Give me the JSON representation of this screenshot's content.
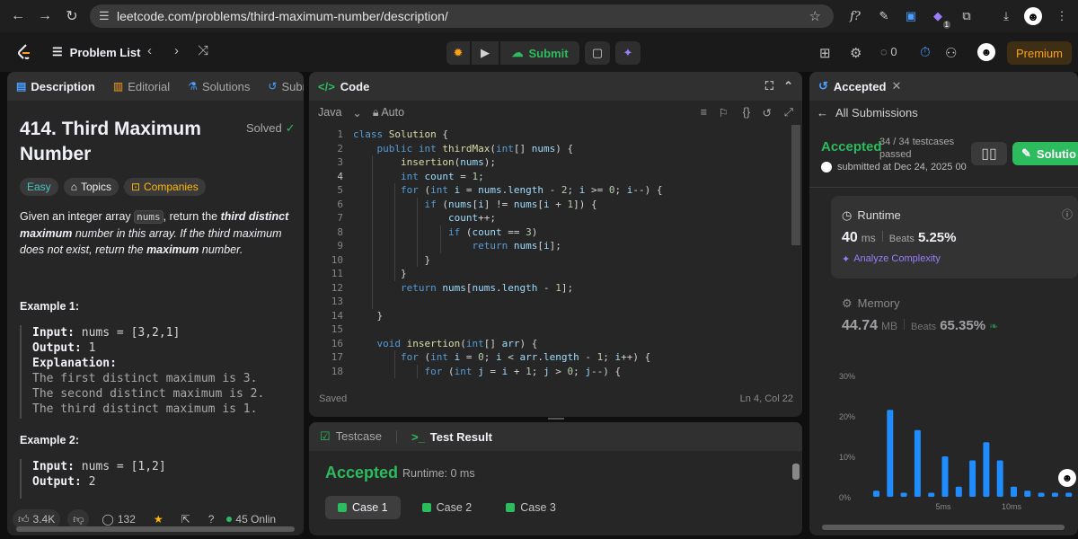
{
  "browser": {
    "url": "leetcode.com/problems/third-maximum-number/description/",
    "ext_badge": "1"
  },
  "nav": {
    "problem_list": "Problem List",
    "submit": "Submit",
    "coins": "0",
    "premium": "Premium"
  },
  "description": {
    "tabs": [
      "Description",
      "Editorial",
      "Solutions",
      "Submis"
    ],
    "title": "414. Third Maximum Number",
    "solved": "Solved",
    "pills": [
      "Easy",
      "Topics",
      "Companies"
    ],
    "text_before": "Given an integer array ",
    "text_code": "nums",
    "text_mid": ", return the ",
    "text_bold1": "third distinct maximum",
    "text_italic": " number in this array. If the third maximum does not exist, return the ",
    "text_bold2": "maximum",
    "text_end": " number.",
    "example1_title": "Example 1:",
    "example1_input_k": "Input:",
    "example1_input_v": " nums = [3,2,1]",
    "example1_output_k": "Output:",
    "example1_output_v": " 1",
    "example1_expl_k": "Explanation:",
    "example1_lines": [
      "The first distinct maximum is 3.",
      "The second distinct maximum is 2.",
      "The third distinct maximum is 1."
    ],
    "example2_title": "Example 2:",
    "example2_input_k": "Input:",
    "example2_input_v": " nums = [1,2]",
    "example2_output_k": "Output:",
    "example2_output_v": " 2",
    "likes": "3.4K",
    "comments": "132",
    "online": "45 Onlin"
  },
  "code": {
    "header": "Code",
    "language": "Java",
    "mode": "Auto",
    "status_left": "Saved",
    "status_right": "Ln 4, Col 22",
    "lines": [
      "class Solution {",
      "    public int thirdMax(int[] nums) {",
      "        insertion(nums);",
      "        int count = 1;",
      "        for (int i = nums.length - 2; i >= 0; i--) {",
      "            if (nums[i] != nums[i + 1]) {",
      "                count++;",
      "                if (count == 3)",
      "                    return nums[i];",
      "            }",
      "        }",
      "        return nums[nums.length - 1];",
      "",
      "    }",
      "",
      "    void insertion(int[] arr) {",
      "        for (int i = 0; i < arr.length - 1; i++) {",
      "            for (int j = i + 1; j > 0; j--) {"
    ]
  },
  "test": {
    "tab_testcase": "Testcase",
    "tab_result": "Test Result",
    "status": "Accepted",
    "runtime": "Runtime: 0 ms",
    "cases": [
      "Case 1",
      "Case 2",
      "Case 3"
    ]
  },
  "submission": {
    "tab": "Accepted",
    "all": "All Submissions",
    "status": "Accepted",
    "cases": "34 / 34 testcases passed",
    "submitted": "submitted at Dec 24, 2025 00",
    "solution": "Solutio",
    "runtime_title": "Runtime",
    "runtime_value": "40",
    "runtime_unit": "ms",
    "runtime_beats_label": "Beats",
    "runtime_beats": "5.25%",
    "analyze": "Analyze Complexity",
    "memory_title": "Memory",
    "memory_value": "44.74",
    "memory_unit": "MB",
    "memory_beats_label": "Beats",
    "memory_beats": "65.35%"
  },
  "chart_data": {
    "type": "bar",
    "yticks": [
      "30%",
      "20%",
      "10%",
      "0%"
    ],
    "ylim": [
      0,
      30
    ],
    "xticks": [
      "5ms",
      "10ms"
    ],
    "values": [
      1.5,
      21.5,
      1,
      16.5,
      1,
      10,
      2.5,
      9,
      13.5,
      9,
      2.5,
      1.5,
      1,
      1,
      1,
      1
    ],
    "color": "#1f8cff"
  }
}
